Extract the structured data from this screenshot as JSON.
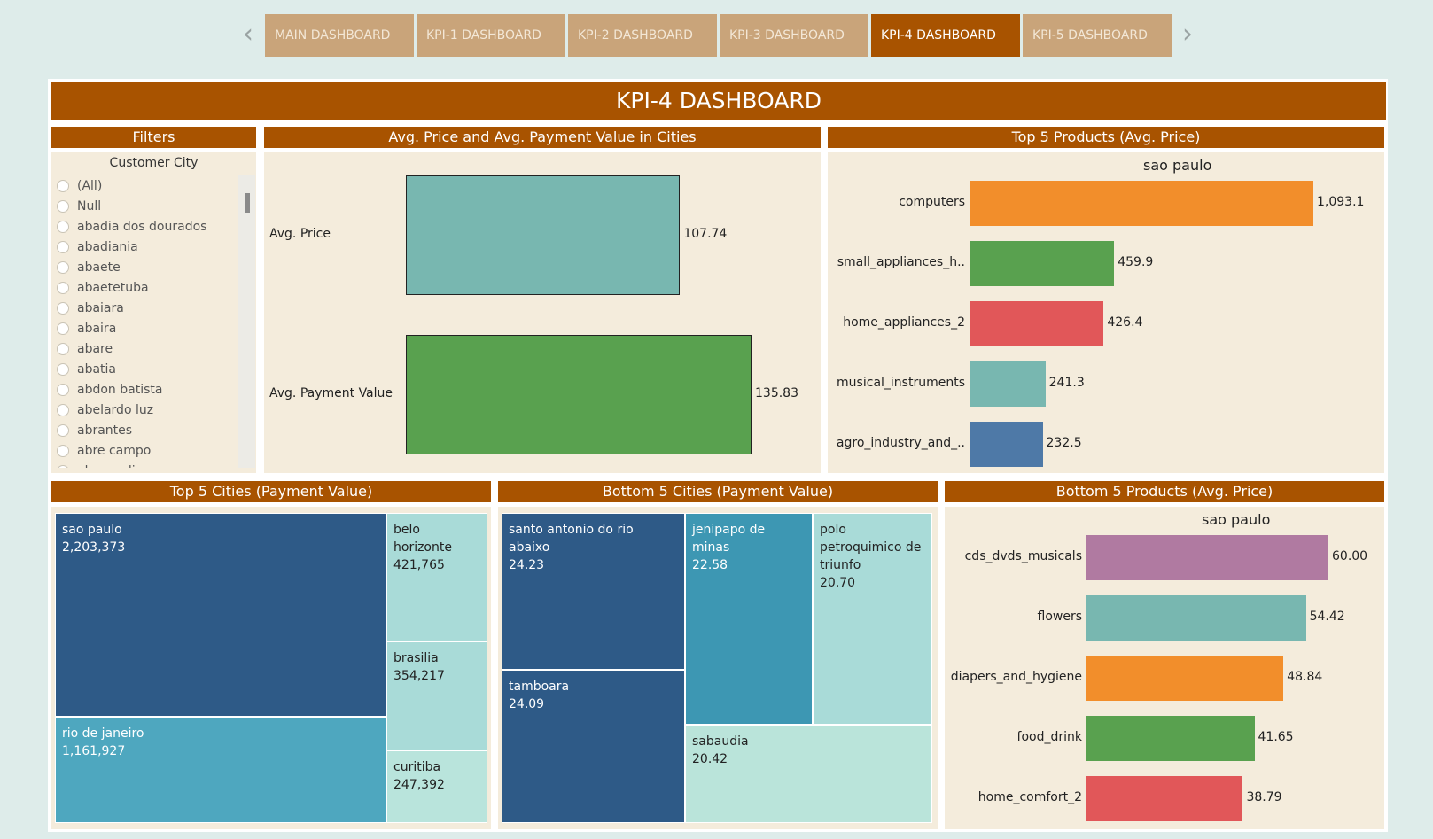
{
  "nav": {
    "tabs": [
      {
        "label": "MAIN DASHBOARD"
      },
      {
        "label": "KPI-1 DASHBOARD"
      },
      {
        "label": "KPI-2 DASHBOARD"
      },
      {
        "label": "KPI-3 DASHBOARD"
      },
      {
        "label": "KPI-4 DASHBOARD"
      },
      {
        "label": "KPI-5 DASHBOARD"
      }
    ],
    "active_tab": "KPI-4 DASHBOARD",
    "prev_icon": "chevron-left-icon",
    "next_icon": "chevron-right-icon",
    "prev_glyph": "‹",
    "next_glyph": "›"
  },
  "colors": {
    "header_brown": "#a85300",
    "tab_inactive": "#c9a47a",
    "panel_bg": "#f4ecdc",
    "teal": "#78b7b0",
    "green": "#59a14f",
    "orange": "#f28e2b",
    "red": "#e15759",
    "blue": "#4e79a7",
    "purple": "#b07aa1"
  },
  "dashboard": {
    "title": "KPI-4 DASHBOARD"
  },
  "filters": {
    "header": "Filters",
    "field_label": "Customer City",
    "items": [
      "(All)",
      "Null",
      "abadia dos dourados",
      "abadiania",
      "abaete",
      "abaetetuba",
      "abaiara",
      "abaira",
      "abare",
      "abatia",
      "abdon batista",
      "abelardo luz",
      "abrantes",
      "abre campo",
      "abreu e lima"
    ]
  },
  "charts": {
    "price_payment": {
      "header": "Avg. Price and Avg. Payment Value in Cities",
      "chart_data": {
        "type": "bar",
        "orientation": "horizontal",
        "categories": [
          "Avg. Price",
          "Avg. Payment Value"
        ],
        "values": [
          107.74,
          135.83
        ],
        "value_labels": [
          "107.74",
          "135.83"
        ],
        "colors": [
          "#78b7b0",
          "#59a14f"
        ]
      }
    },
    "top_products": {
      "header": "Top 5 Products (Avg. Price)",
      "chart_data": {
        "type": "bar",
        "orientation": "horizontal",
        "subtitle": "sao paulo",
        "categories": [
          "computers",
          "small_appliances_h..",
          "home_appliances_2",
          "musical_instruments",
          "agro_industry_and_.."
        ],
        "values": [
          1093.1,
          459.9,
          426.4,
          241.3,
          232.5
        ],
        "value_labels": [
          "1,093.1",
          "459.9",
          "426.4",
          "241.3",
          "232.5"
        ],
        "colors": [
          "#f28e2b",
          "#59a14f",
          "#e15759",
          "#78b7b0",
          "#4e79a7"
        ]
      }
    },
    "bottom_products": {
      "header": "Bottom 5 Products (Avg. Price)",
      "chart_data": {
        "type": "bar",
        "orientation": "horizontal",
        "subtitle": "sao paulo",
        "categories": [
          "cds_dvds_musicals",
          "flowers",
          "diapers_and_hygiene",
          "food_drink",
          "home_comfort_2"
        ],
        "values": [
          60.0,
          54.42,
          48.84,
          41.65,
          38.79
        ],
        "value_labels": [
          "60.00",
          "54.42",
          "48.84",
          "41.65",
          "38.79"
        ],
        "colors": [
          "#b07aa1",
          "#78b7b0",
          "#f28e2b",
          "#59a14f",
          "#e15759"
        ]
      }
    },
    "top_cities": {
      "header": "Top 5 Cities (Payment Value)",
      "chart_data": {
        "type": "treemap",
        "categories": [
          "sao paulo",
          "rio de janeiro",
          "belo horizonte",
          "brasilia",
          "curitiba"
        ],
        "values": [
          2203373,
          1161927,
          421765,
          354217,
          247392
        ],
        "value_labels": [
          "2,203,373",
          "1,161,927",
          "421,765",
          "354,217",
          "247,392"
        ],
        "colors": [
          "#2e5a87",
          "#4ea7bf",
          "#a9dbd8",
          "#a9dbd8",
          "#b9e4dc"
        ]
      }
    },
    "bottom_cities": {
      "header": "Bottom 5 Cities (Payment Value)",
      "chart_data": {
        "type": "treemap",
        "categories": [
          "santo antonio do rio abaixo",
          "tamboara",
          "jenipapo de minas",
          "polo petroquimico de triunfo",
          "sabaudia"
        ],
        "values": [
          24.23,
          24.09,
          22.58,
          20.7,
          20.42
        ],
        "value_labels": [
          "24.23",
          "24.09",
          "22.58",
          "20.70",
          "20.42"
        ],
        "colors": [
          "#2e5a87",
          "#2e5a87",
          "#3d97b3",
          "#a9dbd8",
          "#bae4da"
        ]
      }
    }
  }
}
